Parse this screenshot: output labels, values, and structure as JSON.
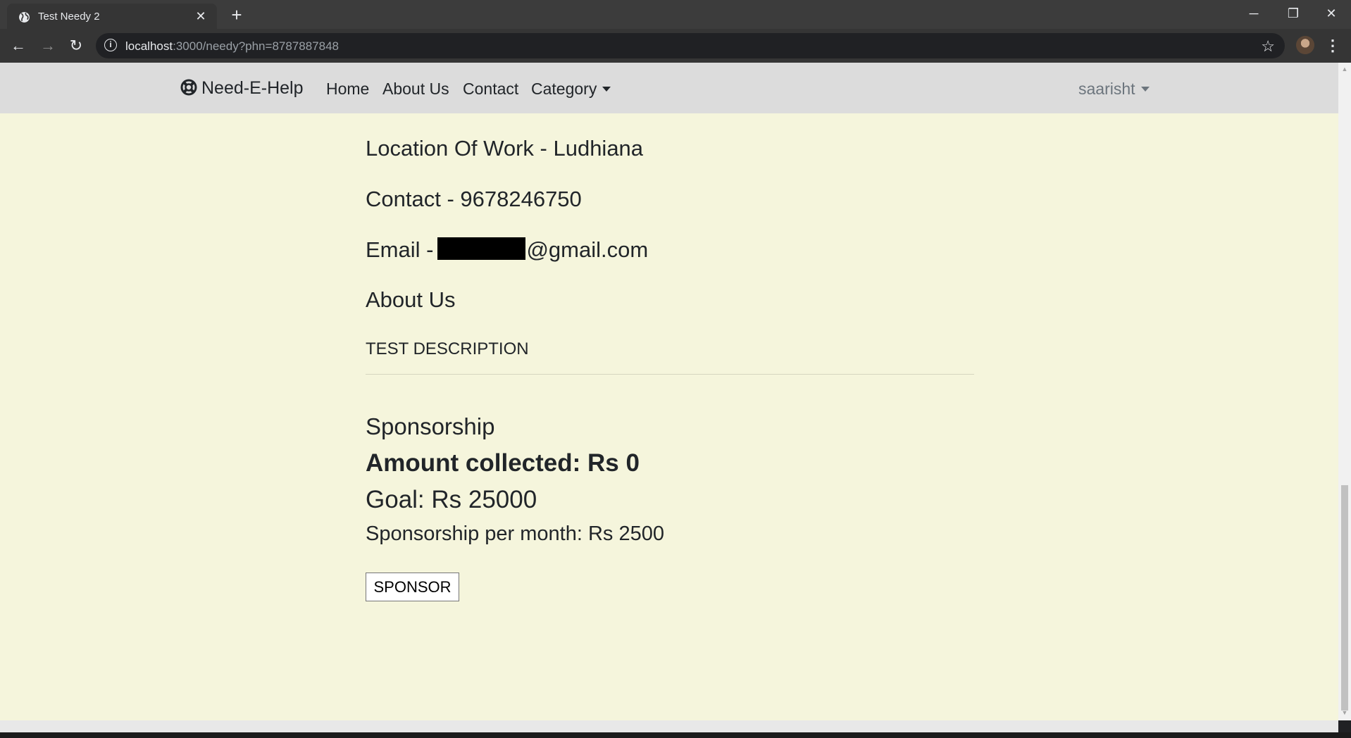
{
  "browser": {
    "tab_title": "Test Needy 2",
    "tab_close": "✕",
    "new_tab": "+",
    "url_host": "localhost",
    "url_rest": ":3000/needy?phn=8787887848",
    "window_minimize": "─",
    "window_restore": "❐",
    "window_close": "✕",
    "back": "←",
    "forward": "→",
    "reload": "↻",
    "bookmark": "☆",
    "menu": "⋮"
  },
  "navbar": {
    "brand": "Need-E-Help",
    "links": [
      "Home",
      "About Us",
      "Contact",
      "Category"
    ],
    "user": "saarisht"
  },
  "profile": {
    "location": "Location Of Work - Ludhiana",
    "contact": "Contact - 9678246750",
    "email_prefix": "Email -",
    "email_domain": "@gmail.com",
    "about_heading": "About Us",
    "description": "TEST DESCRIPTION"
  },
  "sponsorship": {
    "heading": "Sponsorship",
    "amount_collected": "Amount collected: Rs 0",
    "goal": "Goal: Rs 25000",
    "per_month": "Sponsorship per month: Rs 2500",
    "button_label": "SPONSOR"
  },
  "colors": {
    "page_bg": "#f5f5dc",
    "navbar_bg": "#dcdcdc",
    "text": "#212529",
    "muted": "#6c757d"
  }
}
